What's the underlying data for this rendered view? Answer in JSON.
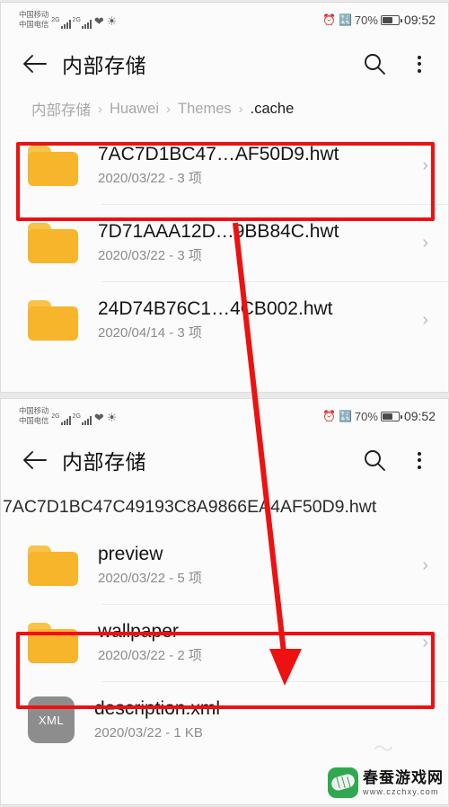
{
  "status_bar": {
    "carrier_primary": "中国移动",
    "carrier_secondary": "中国电信",
    "network_tag_1": "2G",
    "network_tag_2": "2G",
    "alarm_icon": "alarm-clock-icon",
    "bluetooth_icon": "bluetooth-icon",
    "battery_percent": "70%",
    "battery_level": 70,
    "time": "09:52"
  },
  "app_bar": {
    "back_icon": "back-arrow-icon",
    "title": "内部存储",
    "search_icon": "search-icon",
    "menu_icon": "overflow-menu-icon"
  },
  "screen_top": {
    "breadcrumb": [
      {
        "label": "内部存储",
        "active": false
      },
      {
        "label": "Huawei",
        "active": false
      },
      {
        "label": "Themes",
        "active": false
      },
      {
        "label": ".cache",
        "active": true
      }
    ],
    "separator": "›",
    "files": [
      {
        "icon": "folder-icon",
        "name": "7AC7D1BC47…AF50D9.hwt",
        "meta": "2020/03/22 - 3 项",
        "chevron": "›",
        "highlighted": true
      },
      {
        "icon": "folder-icon",
        "name": "7D71AAA12D…9BB84C.hwt",
        "meta": "2020/03/22 - 3 项",
        "chevron": "›",
        "highlighted": false
      },
      {
        "icon": "folder-icon",
        "name": "24D74B76C1…4CB002.hwt",
        "meta": "2020/04/14 - 3 项",
        "chevron": "›",
        "highlighted": false
      }
    ]
  },
  "screen_bottom": {
    "path_line": "7AC7D1BC47C49193C8A9866EA4AF50D9.hwt",
    "files": [
      {
        "icon": "folder-icon",
        "name": "preview",
        "meta": "2020/03/22 - 5 项",
        "chevron": "›",
        "highlighted": false
      },
      {
        "icon": "folder-icon",
        "name": "wallpaper",
        "meta": "2020/03/22 - 2 项",
        "chevron": "›",
        "highlighted": true
      },
      {
        "icon": "xml-file-icon",
        "name": "description.xml",
        "meta": "2020/03/22 - 1 KB",
        "chevron": "",
        "highlighted": false,
        "badge": "XML"
      }
    ]
  },
  "annotations": {
    "highlight_color": "#ee1111",
    "arrow_color": "#ee1111",
    "arrow_description": "red-arrow-from-top-folder-to-wallpaper-folder"
  },
  "watermark": {
    "site_name": "春蚕游戏网",
    "url": "www.czchxy.com"
  }
}
